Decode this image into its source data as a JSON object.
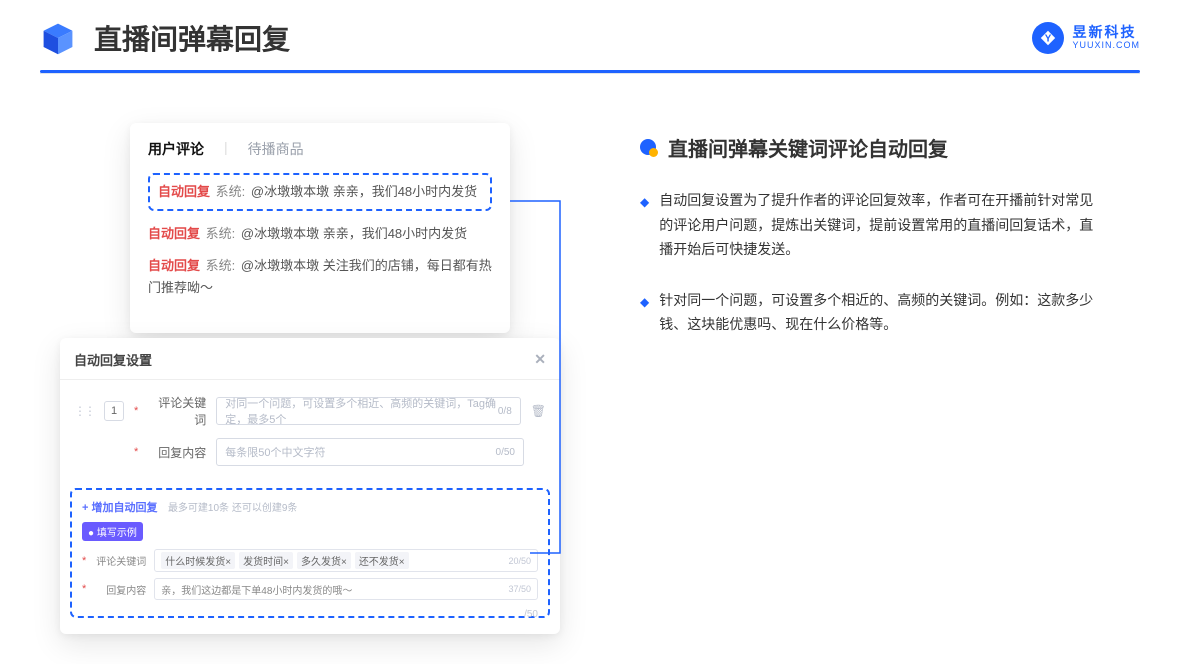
{
  "header": {
    "title": "直播间弹幕回复",
    "logo_text": "昱新科技",
    "logo_sub": "YUUXIN.COM"
  },
  "comments_card": {
    "tabs": {
      "active": "用户评论",
      "inactive": "待播商品"
    },
    "rows": [
      {
        "ar": "自动回复",
        "sys": "系统:",
        "text": "@冰墩墩本墩 亲亲，我们48小时内发货",
        "highlight": true
      },
      {
        "ar": "自动回复",
        "sys": "系统:",
        "text": "@冰墩墩本墩 亲亲，我们48小时内发货",
        "highlight": false
      },
      {
        "ar": "自动回复",
        "sys": "系统:",
        "text": "@冰墩墩本墩 关注我们的店铺，每日都有热门推荐呦～",
        "highlight": false
      }
    ]
  },
  "settings_card": {
    "title": "自动回复设置",
    "row_number": "1",
    "fields": {
      "keyword_label": "评论关键词",
      "keyword_placeholder": "对同一个问题，可设置多个相近、高频的关键词，Tag确定，最多5个",
      "keyword_counter": "0/8",
      "content_label": "回复内容",
      "content_placeholder": "每条限50个中文字符",
      "content_counter": "0/50"
    },
    "add_link": "+ 增加自动回复",
    "add_hint": "最多可建10条 还可以创建9条",
    "example_badge": "● 填写示例",
    "example": {
      "keyword_label": "评论关键词",
      "keyword_tags": [
        "什么时候发货×",
        "发货时间×",
        "多久发货×",
        "还不发货×"
      ],
      "keyword_counter": "20/50",
      "content_label": "回复内容",
      "content_text": "亲，我们这边都是下单48小时内发货的哦～",
      "content_counter": "37/50"
    },
    "extra_counter": "/50"
  },
  "right": {
    "section_title": "直播间弹幕关键词评论自动回复",
    "bullets": [
      "自动回复设置为了提升作者的评论回复效率，作者可在开播前针对常见的评论用户问题，提炼出关键词，提前设置常用的直播间回复话术，直播开始后可快捷发送。",
      "针对同一个问题，可设置多个相近的、高频的关键词。例如：这款多少钱、这块能优惠吗、现在什么价格等。"
    ]
  }
}
